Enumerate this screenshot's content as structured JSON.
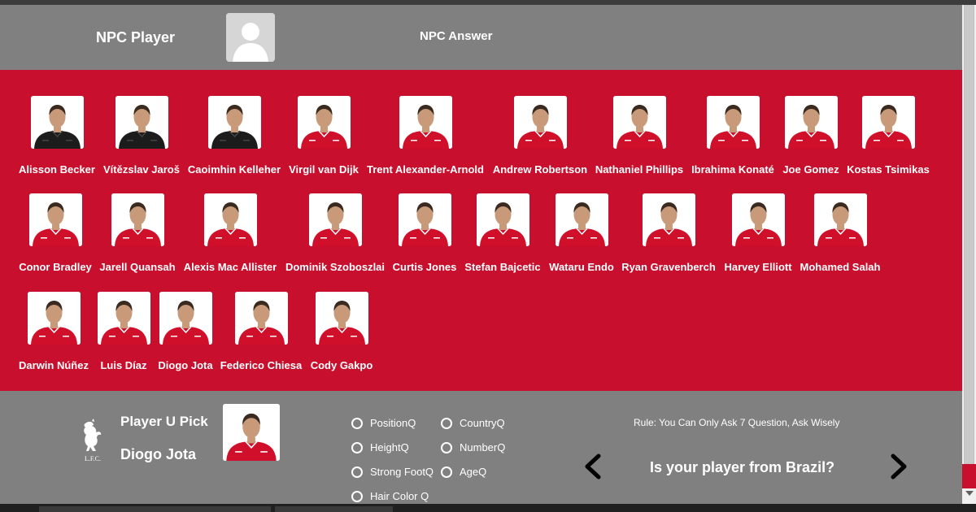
{
  "header": {
    "npc_label": "NPC Player",
    "npc_answer_label": "NPC Answer"
  },
  "players": [
    {
      "name": "Alisson Becker",
      "kit": "black"
    },
    {
      "name": "Vítězslav Jaroš",
      "kit": "black"
    },
    {
      "name": "Caoimhin Kelleher",
      "kit": "black"
    },
    {
      "name": "Virgil van Dijk",
      "kit": "red"
    },
    {
      "name": "Trent Alexander-Arnold",
      "kit": "red"
    },
    {
      "name": "Andrew Robertson",
      "kit": "red"
    },
    {
      "name": "Nathaniel Phillips",
      "kit": "red"
    },
    {
      "name": "Ibrahima Konaté",
      "kit": "red"
    },
    {
      "name": "Joe Gomez",
      "kit": "red"
    },
    {
      "name": "Kostas Tsimikas",
      "kit": "red"
    },
    {
      "name": "Conor Bradley",
      "kit": "red"
    },
    {
      "name": "Jarell Quansah",
      "kit": "red"
    },
    {
      "name": "Alexis Mac Allister",
      "kit": "red"
    },
    {
      "name": "Dominik Szoboszlai",
      "kit": "red"
    },
    {
      "name": "Curtis Jones",
      "kit": "red"
    },
    {
      "name": "Stefan Bajcetic",
      "kit": "red"
    },
    {
      "name": "Wataru Endo",
      "kit": "red"
    },
    {
      "name": "Ryan Gravenberch",
      "kit": "red"
    },
    {
      "name": "Harvey Elliott",
      "kit": "red"
    },
    {
      "name": "Mohamed Salah",
      "kit": "red"
    },
    {
      "name": "Darwin Núñez",
      "kit": "red"
    },
    {
      "name": "Luis Díaz",
      "kit": "red"
    },
    {
      "name": "Diogo Jota",
      "kit": "red"
    },
    {
      "name": "Federico Chiesa",
      "kit": "red"
    },
    {
      "name": "Cody Gakpo",
      "kit": "red"
    }
  ],
  "pick": {
    "label": "Player U Pick",
    "name": "Diogo Jota"
  },
  "questions": {
    "position": "PositionQ",
    "country": "CountryQ",
    "height": "HeightQ",
    "number": "NumberQ",
    "strong_foot": "Strong FootQ",
    "age": "AgeQ",
    "hair_color": "Hair Color Q"
  },
  "rule_text": "Rule: You Can Only Ask 7 Question, Ask Wisely",
  "current_question": "Is your player from Brazil?",
  "colors": {
    "liverpool_red": "#c8102e",
    "panel_gray": "#808080"
  },
  "icons": {
    "prev": "chevron-left-icon",
    "next": "chevron-right-icon",
    "logo": "liverbird-logo-icon"
  }
}
